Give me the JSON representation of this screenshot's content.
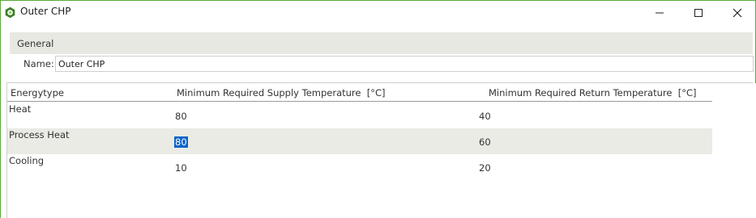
{
  "window": {
    "title": "Outer CHP",
    "icon": "hexagon-logo-icon",
    "accent_color": "#5aa83a"
  },
  "general": {
    "group_label": "General",
    "name_label": "Name:",
    "name_value": "Outer CHP"
  },
  "grid": {
    "columns": [
      "Energytype",
      "Minimum Required Supply Temperature  [°C]",
      "Minimum Required Return Temperature  [°C]"
    ],
    "rows": [
      {
        "energytype": "Heat",
        "supply": "80",
        "return": "40"
      },
      {
        "energytype": "Process Heat",
        "supply": "80",
        "return": "60",
        "selected_cell": "supply"
      },
      {
        "energytype": "Cooling",
        "supply": "10",
        "return": "20"
      }
    ],
    "selection_color": "#0a64c8",
    "alt_row_color": "#e9ebe4"
  }
}
